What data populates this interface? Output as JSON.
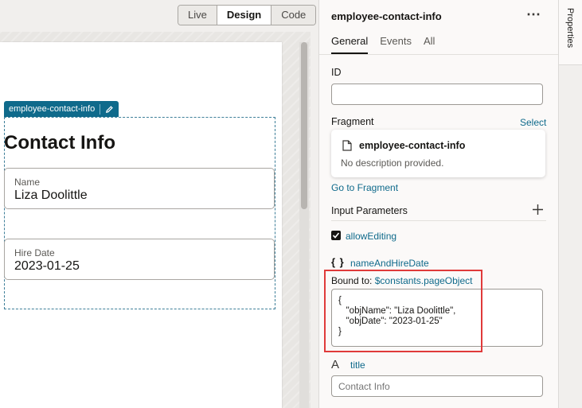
{
  "toolbar": {
    "modes": [
      "Live",
      "Design",
      "Code"
    ],
    "active_mode": "Design"
  },
  "canvas": {
    "fragment_tag": "employee-contact-info",
    "heading": "Contact Info",
    "fields": [
      {
        "label": "Name",
        "value": "Liza Doolittle"
      },
      {
        "label": "Hire Date",
        "value": "2023-01-25"
      }
    ]
  },
  "panel": {
    "title": "employee-contact-info",
    "more": "⋯",
    "tabs": [
      "General",
      "Events",
      "All"
    ],
    "active_tab": "General",
    "id_label": "ID",
    "id_value": "",
    "fragment_label": "Fragment",
    "select_link": "Select",
    "fragment_name": "employee-contact-info",
    "fragment_desc": "No description provided.",
    "goto_link": "Go to Fragment",
    "params_label": "Input Parameters",
    "params": {
      "allow_editing": {
        "name": "allowEditing",
        "checked": true
      },
      "name_and_hire": {
        "icon": "{ }",
        "name": "nameAndHireDate",
        "bound_prefix": "Bound to: ",
        "bound_value": "$constants.pageObject",
        "json_lines": [
          "{",
          "   \"objName\": \"Liza Doolittle\",",
          "   \"objDate\": \"2023-01-25\"",
          "}"
        ]
      },
      "title": {
        "icon": "A",
        "name": "title",
        "placeholder": "Contact Info"
      }
    }
  },
  "side": {
    "tab_label": "Properties"
  },
  "colors": {
    "accent": "#0f6a8b",
    "highlight": "#e03a3a"
  }
}
